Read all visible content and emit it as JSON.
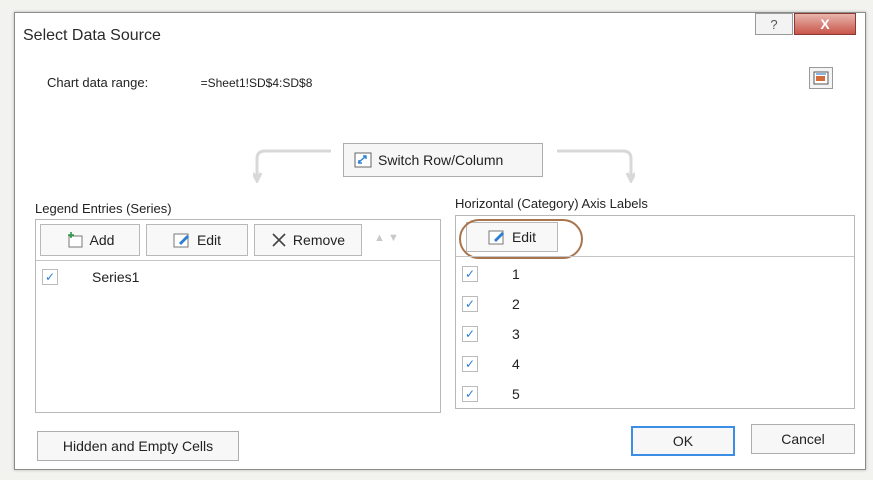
{
  "dialog": {
    "title": "Select Data Source",
    "help_glyph": "?",
    "close_glyph": "X",
    "chart_range_label": "Chart data range:",
    "chart_range_value": "=Sheet1!SD$4:SD$8",
    "switch_label": "Switch Row/Column"
  },
  "legend": {
    "label": "Legend Entries (Series)",
    "add_label": "Add",
    "edit_label": "Edit",
    "remove_label": "Remove",
    "series": [
      {
        "checked": true,
        "name": "Series1"
      }
    ]
  },
  "axis": {
    "label": "Horizontal (Category) Axis Labels",
    "edit_label": "Edit",
    "items": [
      {
        "checked": true,
        "value": "1"
      },
      {
        "checked": true,
        "value": "2"
      },
      {
        "checked": true,
        "value": "3"
      },
      {
        "checked": true,
        "value": "4"
      },
      {
        "checked": true,
        "value": "5"
      }
    ]
  },
  "footer": {
    "hidden_label": "Hidden and Empty Cells",
    "ok_label": "OK",
    "cancel_label": "Cancel"
  },
  "icons": {
    "help": "help-icon",
    "close": "close-icon",
    "collapse": "collapse-dialog-icon",
    "switch": "switch-row-column-icon",
    "add": "add-series-icon",
    "edit": "edit-icon",
    "remove": "remove-icon",
    "move": "move-arrows-icon"
  },
  "colors": {
    "accent": "#3a8ee6",
    "annotation": "#a8754e",
    "check": "#2a7fd3"
  }
}
